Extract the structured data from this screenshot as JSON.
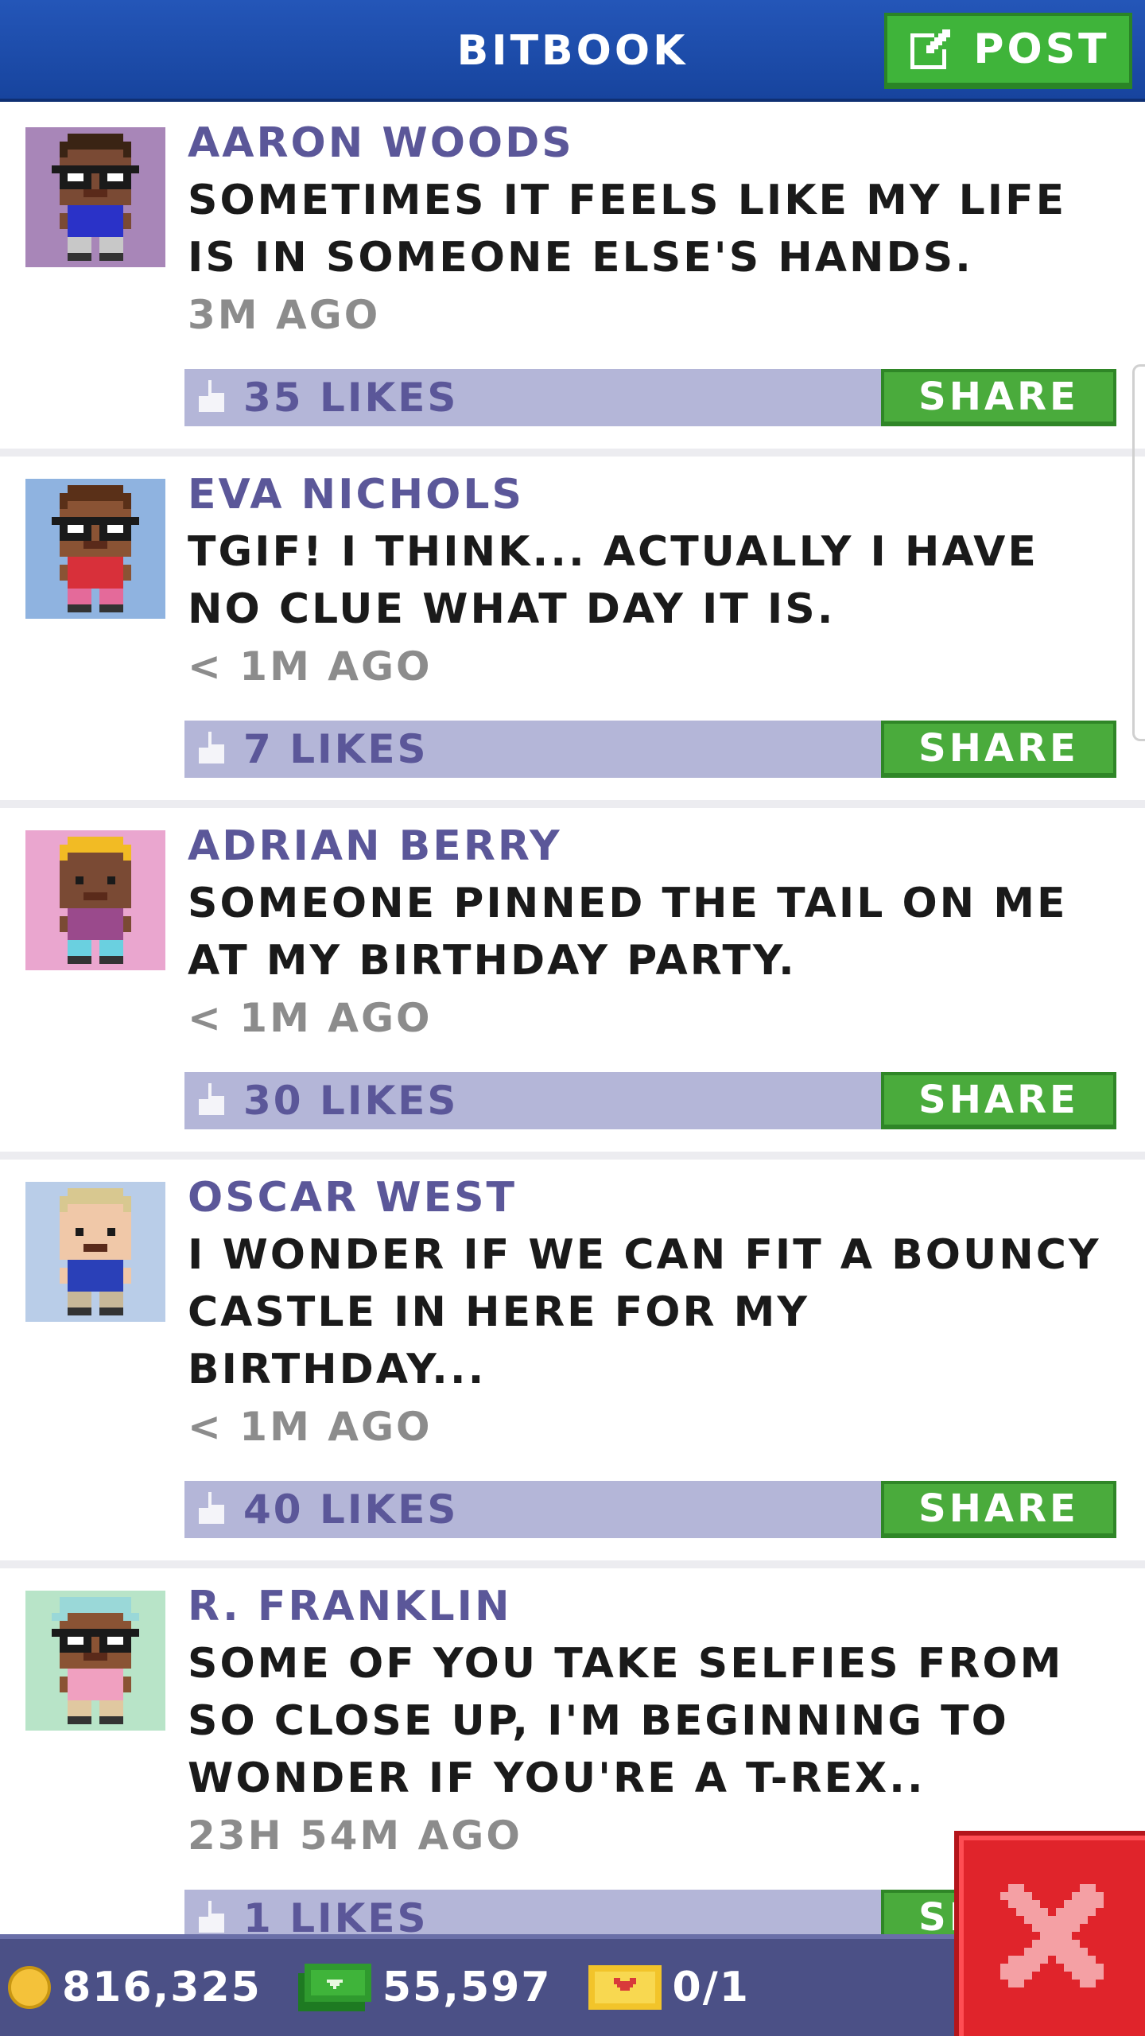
{
  "header": {
    "title": "BITBOOK",
    "post_label": "POST"
  },
  "colors": {
    "header": "#2456b8",
    "accent_green": "#4aab3c",
    "likes_bar": "#b4b6d8",
    "author": "#5b5799",
    "close_red": "#e0242b",
    "bottom_bar": "#4b5086"
  },
  "posts": [
    {
      "author": "AARON WOODS",
      "message": "SOMETIMES IT FEELS LIKE MY LIFE IS IN SOMEONE ELSE'S HANDS.",
      "time": "3M AGO",
      "likes": "35 LIKES",
      "share_label": "SHARE",
      "avatar_bg": "#a886b8",
      "skin": "#7a4a34",
      "hair": "#3a2414",
      "shirt": "#2a32c8",
      "pants": "#c8c8c8",
      "glasses": true,
      "hat": "none"
    },
    {
      "author": "EVA NICHOLS",
      "message": "TGIF! I THINK... ACTUALLY I HAVE NO CLUE WHAT DAY IT IS.",
      "time": "< 1M AGO",
      "likes": "7 LIKES",
      "share_label": "SHARE",
      "avatar_bg": "#8fb3e0",
      "skin": "#8a5334",
      "hair": "#5a3018",
      "shirt": "#d8303a",
      "pants": "#e46a9a",
      "glasses": true,
      "hat": "none"
    },
    {
      "author": "ADRIAN BERRY",
      "message": "SOMEONE PINNED THE TAIL ON ME AT MY BIRTHDAY PARTY.",
      "time": "< 1M AGO",
      "likes": "30 LIKES",
      "share_label": "SHARE",
      "avatar_bg": "#eaa6cf",
      "skin": "#7a4a34",
      "hair": "#f2bb24",
      "shirt": "#9a4a8c",
      "pants": "#6ad0e0",
      "glasses": false,
      "hat": "none"
    },
    {
      "author": "OSCAR WEST",
      "message": "I WONDER IF WE CAN FIT A BOUNCY CASTLE IN HERE FOR MY BIRTHDAY...",
      "time": "< 1M AGO",
      "likes": "40 LIKES",
      "share_label": "SHARE",
      "avatar_bg": "#b9cde8",
      "skin": "#f0c8a8",
      "hair": "#d8c890",
      "shirt": "#2a40b8",
      "pants": "#c8b898",
      "glasses": false,
      "hat": "none"
    },
    {
      "author": "R. FRANKLIN",
      "message": "SOME OF YOU TAKE SELFIES FROM SO CLOSE UP, I'M BEGINNING TO WONDER IF YOU'RE A T-REX..",
      "time": "23H 54M AGO",
      "likes": "1 LIKES",
      "share_label": "SHARE",
      "avatar_bg": "#b8e4c8",
      "skin": "#8a5334",
      "hair": "#9ad8d8",
      "shirt": "#f0a0c0",
      "pants": "#e0c8a0",
      "glasses": true,
      "hat": "cap"
    }
  ],
  "bottom_bar": {
    "coins": "816,325",
    "bux": "55,597",
    "tickets": "0/1"
  },
  "icons": {
    "post": "edit-icon",
    "like": "thumbs-up-icon",
    "coin": "coin-icon",
    "bux": "cash-icon",
    "ticket": "ticket-icon",
    "close": "close-icon"
  }
}
